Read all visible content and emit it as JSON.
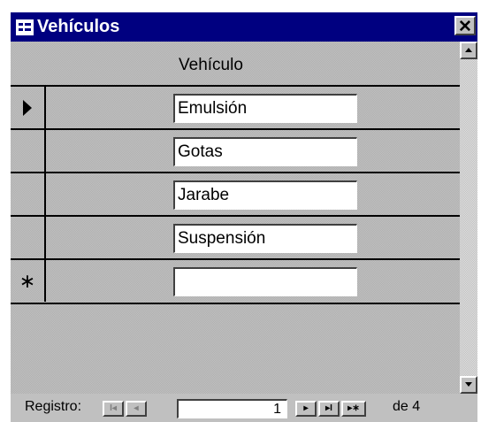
{
  "window": {
    "title": "Vehículos",
    "close_glyph": "✕",
    "title_icon": "datasheet-icon"
  },
  "table": {
    "column_header": "Vehículo",
    "rows": [
      {
        "selector": "current",
        "value": "Emulsión"
      },
      {
        "selector": "",
        "value": "Gotas"
      },
      {
        "selector": "",
        "value": "Jarabe"
      },
      {
        "selector": "",
        "value": "Suspensión"
      }
    ],
    "new_row_selector": "∗",
    "new_row_value": ""
  },
  "navigation": {
    "label": "Registro:",
    "first_glyph": "I◂",
    "prev_glyph": "◂",
    "current_record": "1",
    "next_glyph": "▸",
    "last_glyph": "▸I",
    "new_glyph": "▸∗",
    "total_text": "de 4"
  },
  "colors": {
    "titlebar": "#000080",
    "window_face": "#c0c0c0"
  }
}
